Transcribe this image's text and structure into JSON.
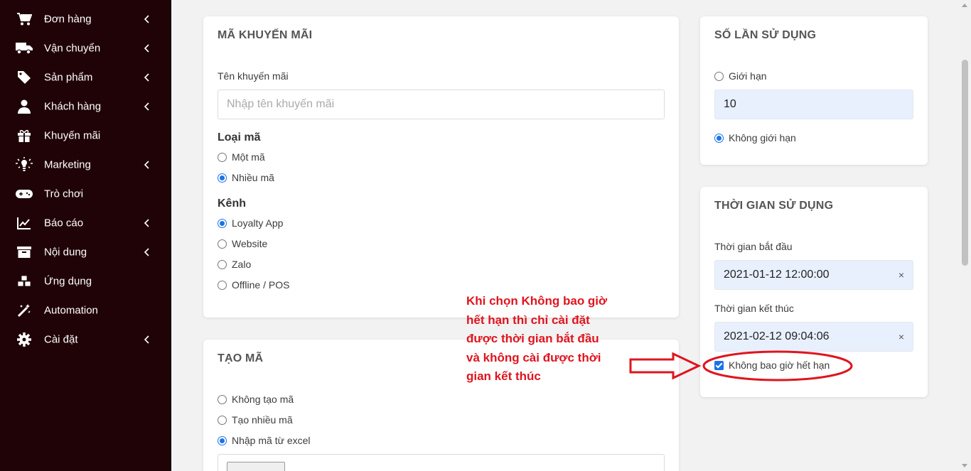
{
  "sidebar": {
    "items": [
      {
        "label": "Đơn hàng",
        "icon": "cart-icon"
      },
      {
        "label": "Vận chuyển",
        "icon": "truck-icon"
      },
      {
        "label": "Sản phẩm",
        "icon": "tag-icon"
      },
      {
        "label": "Khách hàng",
        "icon": "user-icon"
      },
      {
        "label": "Khuyến mãi",
        "icon": "gift-icon"
      },
      {
        "label": "Marketing",
        "icon": "lightbulb-icon"
      },
      {
        "label": "Trò chơi",
        "icon": "gamepad-icon"
      },
      {
        "label": "Báo cáo",
        "icon": "chart-line-icon"
      },
      {
        "label": "Nội dung",
        "icon": "archive-icon"
      },
      {
        "label": "Ứng dụng",
        "icon": "cubes-icon"
      },
      {
        "label": "Automation",
        "icon": "magic-wand-icon"
      },
      {
        "label": "Cài đặt",
        "icon": "gear-icon"
      }
    ]
  },
  "promo_card": {
    "title": "MÃ KHUYẾN MÃI",
    "name_label": "Tên khuyến mãi",
    "name_placeholder": "Nhập tên khuyến mãi",
    "code_type_label": "Loại mã",
    "code_type_options": [
      {
        "label": "Một mã",
        "selected": false
      },
      {
        "label": "Nhiều mã",
        "selected": true
      }
    ],
    "channel_label": "Kênh",
    "channel_options": [
      {
        "label": "Loyalty App",
        "selected": true
      },
      {
        "label": "Website",
        "selected": false
      },
      {
        "label": "Zalo",
        "selected": false
      },
      {
        "label": "Offline / POS",
        "selected": false
      }
    ]
  },
  "create_card": {
    "title": "TẠO MÃ",
    "options": [
      {
        "label": "Không tạo mã",
        "selected": false
      },
      {
        "label": "Tạo nhiều mã",
        "selected": false
      },
      {
        "label": "Nhập mã từ excel",
        "selected": true
      }
    ]
  },
  "usage_card": {
    "title": "SỐ LẦN SỬ DỤNG",
    "limit_label": "Giới hạn",
    "limit_value": "10",
    "unlimited_label": "Không giới hạn",
    "limit_selected": false,
    "unlimited_selected": true
  },
  "time_card": {
    "title": "THỜI GIAN SỬ DỤNG",
    "start_label": "Thời gian bắt đầu",
    "start_value": "2021-01-12 12:00:00",
    "end_label": "Thời gian kết thúc",
    "end_value": "2021-02-12 09:04:06",
    "never_expire_label": "Không bao giờ hết hạn",
    "never_expire_checked": true,
    "clear_symbol": "×"
  },
  "annotation": {
    "lines": [
      "Khi chọn Không bao giờ",
      "hết hạn thì chỉ cài đặt",
      "được thời gian bắt đầu",
      "và không cài được thời",
      "gian kết thúc"
    ],
    "color": "#e0141e"
  },
  "colors": {
    "sidebar_bg": "#200307",
    "accent": "#1a73e8",
    "filled_input": "#e8f0fe"
  }
}
